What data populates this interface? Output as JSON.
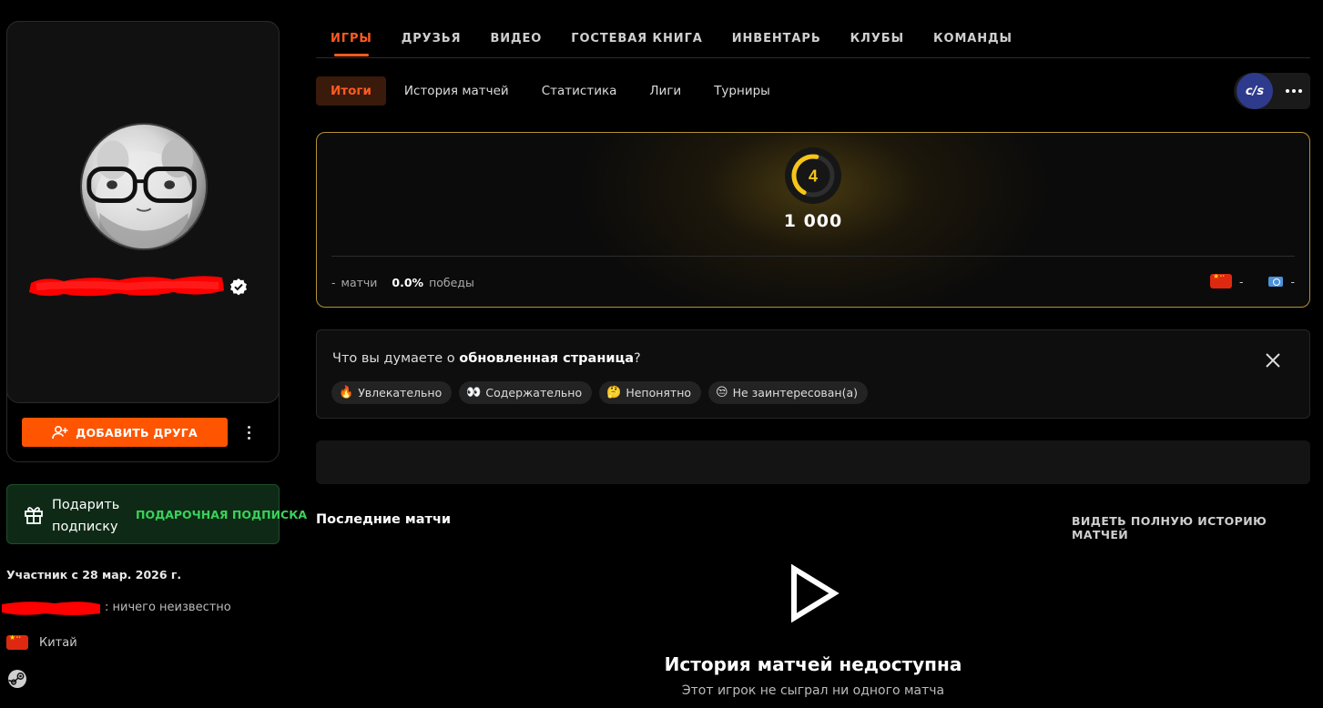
{
  "profile": {
    "add_friend_label": "ДОБАВИТЬ ДРУГА",
    "gift_title": "Подарить подписку",
    "gift_cta": "ПОДАРОЧНАЯ ПОДПИСКА",
    "member_since": "Участник с 28 мар. 2026 г.",
    "about_text": ": ничего неизвестно",
    "country": "Китай"
  },
  "nav": {
    "tabs": [
      {
        "label": "ИГРЫ",
        "active": true
      },
      {
        "label": "ДРУЗЬЯ"
      },
      {
        "label": "ВИДЕО"
      },
      {
        "label": "ГОСТЕВАЯ КНИГА"
      },
      {
        "label": "ИНВЕНТАРЬ"
      },
      {
        "label": "КЛУБЫ"
      },
      {
        "label": "КОМАНДЫ"
      }
    ],
    "subtabs": [
      {
        "label": "Итоги",
        "active": true
      },
      {
        "label": "История матчей"
      },
      {
        "label": "Статистика"
      },
      {
        "label": "Лиги"
      },
      {
        "label": "Турниры"
      }
    ],
    "game_logo": "c/s"
  },
  "elo": {
    "level": "4",
    "level_fraction": 0.45,
    "value": "1 000",
    "matches_value": "-",
    "matches_label": "матчи",
    "winrate_value": "0.0%",
    "winrate_label": "победы",
    "region_cn_value": "-",
    "region_global_value": "-"
  },
  "feedback": {
    "question_prefix": "Что вы думаете о ",
    "question_bold": "обновленная страница",
    "question_suffix": "?",
    "options": [
      {
        "emoji": "🔥",
        "label": "Увлекательно"
      },
      {
        "emoji": "👀",
        "label": "Содержательно"
      },
      {
        "emoji": "🤔",
        "label": "Непонятно"
      },
      {
        "emoji": "😒",
        "label": "Не заинтересован(а)"
      }
    ]
  },
  "recent": {
    "title": "Последние матчи",
    "link": "ВИДЕТЬ ПОЛНУЮ ИСТОРИЮ МАТЧЕЙ",
    "empty_title": "История матчей недоступна",
    "empty_sub": "Этот игрок не сыграл ни одного матча"
  },
  "colors": {
    "accent": "#ff5500",
    "level_ring": "#f5c518",
    "gift_green": "#3ad15b",
    "panel_border": "#b39235"
  },
  "icons": [
    "verified-icon",
    "add-user-icon",
    "more-vertical-icon",
    "gift-icon",
    "steam-icon",
    "more-horizontal-icon",
    "close-icon",
    "play-icon"
  ]
}
